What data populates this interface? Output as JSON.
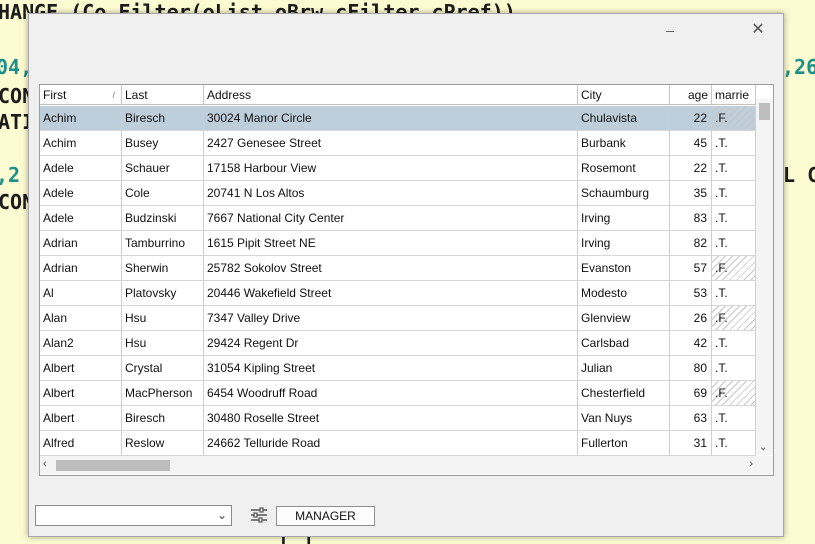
{
  "background_code": {
    "line1": "HANGE (Co Filter(oList oBrw cFilter cPref))",
    "line2_left": "04,",
    "line2_right": ",26",
    "line3_left": "CON",
    "line4_left": "ATI",
    "line5_left": ",2",
    "line5_right": "L C",
    "line6_left": "CON",
    "line7": "[ ]"
  },
  "window": {
    "minimize_icon": "minimize-icon",
    "close_icon": "close-icon"
  },
  "grid": {
    "columns": [
      "First",
      "Last",
      "Address",
      "City",
      "age",
      "marrie"
    ],
    "sort_indicator": "/",
    "rows": [
      {
        "first": "Achim",
        "last": "Biresch",
        "address": "30024 Manor Circle",
        "city": "Chulavista",
        "age": "22",
        "married": ".F.",
        "selected": true
      },
      {
        "first": "Achim",
        "last": "Busey",
        "address": "2427 Genesee Street",
        "city": "Burbank",
        "age": "45",
        "married": ".T."
      },
      {
        "first": "Adele",
        "last": "Schauer",
        "address": "17158 Harbour View",
        "city": "Rosemont",
        "age": "22",
        "married": ".T."
      },
      {
        "first": "Adele",
        "last": "Cole",
        "address": "20741 N Los Altos",
        "city": "Schaumburg",
        "age": "35",
        "married": ".T."
      },
      {
        "first": "Adele",
        "last": "Budzinski",
        "address": "7667 National City Center",
        "city": "Irving",
        "age": "83",
        "married": ".T."
      },
      {
        "first": "Adrian",
        "last": "Tamburrino",
        "address": "1615 Pipit Street NE",
        "city": "Irving",
        "age": "82",
        "married": ".T."
      },
      {
        "first": "Adrian",
        "last": "Sherwin",
        "address": "25782 Sokolov Street",
        "city": "Evanston",
        "age": "57",
        "married": ".F."
      },
      {
        "first": "Al",
        "last": "Platovsky",
        "address": "20446 Wakefield Street",
        "city": "Modesto",
        "age": "53",
        "married": ".T."
      },
      {
        "first": "Alan",
        "last": "Hsu",
        "address": "7347 Valley Drive",
        "city": "Glenview",
        "age": "26",
        "married": ".F."
      },
      {
        "first": "Alan2",
        "last": "Hsu",
        "address": "29424 Regent Dr",
        "city": "Carlsbad",
        "age": "42",
        "married": ".T."
      },
      {
        "first": "Albert",
        "last": "Crystal",
        "address": "31054 Kipling Street",
        "city": "Julian",
        "age": "80",
        "married": ".T."
      },
      {
        "first": "Albert",
        "last": "MacPherson",
        "address": "6454 Woodruff Road",
        "city": "Chesterfield",
        "age": "69",
        "married": ".F."
      },
      {
        "first": "Albert",
        "last": "Biresch",
        "address": "30480 Roselle Street",
        "city": "Van Nuys",
        "age": "63",
        "married": ".T."
      },
      {
        "first": "Alfred",
        "last": "Reslow",
        "address": "24662 Telluride Road",
        "city": "Fullerton",
        "age": "31",
        "married": ".T."
      }
    ]
  },
  "footer": {
    "combo_value": "",
    "manager_label": "MANAGER"
  },
  "colors": {
    "background": "#fdfbd1",
    "selection": "#bfcedb",
    "teal_code": "#1b8f8a"
  }
}
